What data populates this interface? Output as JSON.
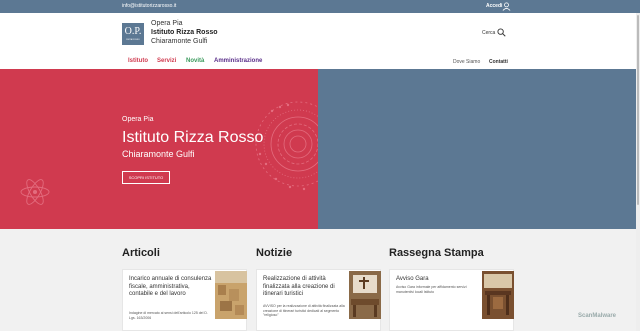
{
  "topbar": {
    "email": "info@istitutorizzarosso.it",
    "login_label": "Accedi"
  },
  "header": {
    "logo_text": "O.P.",
    "logo_small": "RIZZA ROSSO",
    "brand_line1": "Opera Pia",
    "brand_line2": "Istituto Rizza Rosso",
    "brand_line3": "Chiaramonte Gulfi",
    "search_label": "Cerca"
  },
  "nav": {
    "items": [
      "Istituto",
      "Servizi",
      "Novità",
      "Amministrazione"
    ],
    "right_items": [
      "Dove Siamo",
      "Contatti"
    ]
  },
  "hero": {
    "subtitle": "Opera Pia",
    "title": "Istituto Rizza Rosso",
    "place": "Chiaramonte Gulfi",
    "button_label": "SCOPRI ISTITUTO"
  },
  "sections": [
    {
      "title": "Articoli",
      "card_title": "Incarico annuale di consulenza fiscale, amministrativa, contabile e del lavoro",
      "card_text": "Indagine di mercato ai sensi dell'articolo 125 del D. Lgs. 163/2006"
    },
    {
      "title": "Notizie",
      "card_title": "Realizzazione di attività finalizzata alla creazione di itinerari turistici",
      "card_text": "AVVISO per la realizzazione di attività finalizzata alla creazione di itinerari turistici dedicati al segmento \"religioso\""
    },
    {
      "title": "Rassegna Stampa",
      "card_title": "Avviso Gara",
      "card_text": "Avviso Gara informale per affidamento servizi manutentivi locali Istituto"
    }
  ],
  "watermark": "ScanMalware",
  "colors": {
    "topbar": "#5c7893",
    "hero_red": "#d03a4f",
    "hero_blue": "#5c7893",
    "nav_red": "#d03a4f",
    "nav_green": "#3a9a5c",
    "nav_purple": "#5a2f8a"
  }
}
